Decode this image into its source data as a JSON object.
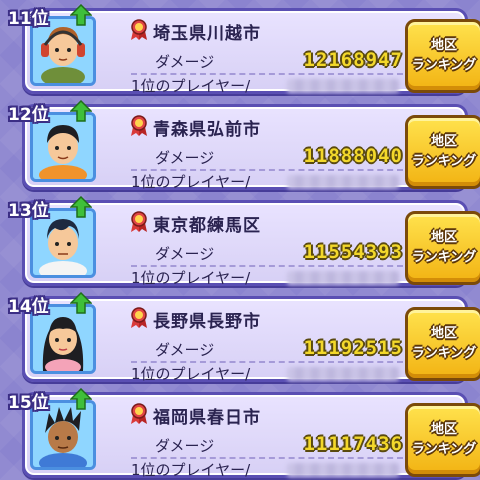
{
  "rankings": [
    {
      "rank": "11位",
      "region": "埼玉県川越市",
      "damage_label": "ダメージ",
      "damage_value": "12168947",
      "player_label": "1位のプレイヤー/",
      "button_line1": "地区",
      "button_line2": "ランキング",
      "avatar": "headphones-boy-avatar"
    },
    {
      "rank": "12位",
      "region": "青森県弘前市",
      "damage_label": "ダメージ",
      "damage_value": "11888040",
      "player_label": "1位のプレイヤー/",
      "button_line1": "地区",
      "button_line2": "ランキング",
      "avatar": "boy-orange-shirt-avatar"
    },
    {
      "rank": "13位",
      "region": "東京都練馬区",
      "damage_label": "ダメージ",
      "damage_value": "11554393",
      "player_label": "1位のプレイヤー/",
      "button_line1": "地区",
      "button_line2": "ランキング",
      "avatar": "boy-white-shirt-avatar"
    },
    {
      "rank": "14位",
      "region": "長野県長野市",
      "damage_label": "ダメージ",
      "damage_value": "11192515",
      "player_label": "1位のプレイヤー/",
      "button_line1": "地区",
      "button_line2": "ランキング",
      "avatar": "girl-long-hair-avatar"
    },
    {
      "rank": "15位",
      "region": "福岡県春日市",
      "damage_label": "ダメージ",
      "damage_value": "11117436",
      "player_label": "1位のプレイヤー/",
      "button_line1": "地区",
      "button_line2": "ランキング",
      "avatar": "spiky-hair-boy-avatar"
    }
  ],
  "colors": {
    "background": "#8b84cf",
    "panel_border": "#5a4fb3",
    "damage_value": "#f3d82b",
    "button": "#f2b313",
    "rank_up_arrow": "#3fbf3a"
  }
}
